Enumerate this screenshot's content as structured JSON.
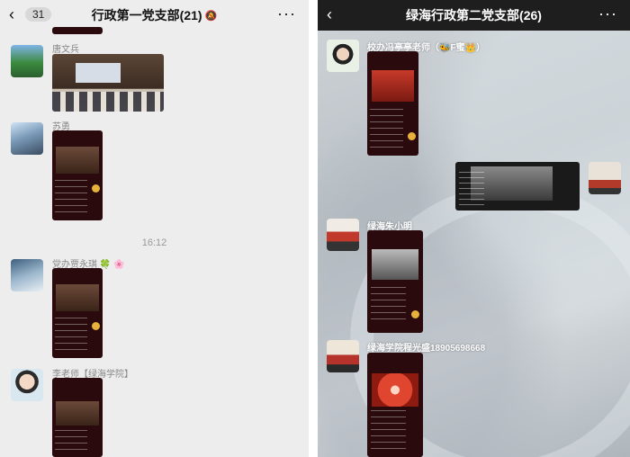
{
  "left": {
    "header": {
      "back_icon": "chevron-left-icon",
      "unread_count": "31",
      "title": "行政第一党支部(21)",
      "mute_icon": "bell-off-icon",
      "more_icon": "more-dots-icon"
    },
    "messages": [
      {
        "sender": "唐文兵"
      },
      {
        "sender": "苏勇"
      },
      {
        "sender": "党办贾永琪 🍀 🌸"
      },
      {
        "sender": "李老师【绿海学院】"
      }
    ],
    "timestamp": "16:12"
  },
  "right": {
    "header": {
      "back_icon": "chevron-left-icon",
      "title": "绿海行政第二党支部(26)",
      "more_icon": "more-dots-icon"
    },
    "messages": [
      {
        "sender": "校办冯亭亭老师（🐝F蜜👑）"
      },
      {
        "sender": "绿海朱小明"
      },
      {
        "sender": "绿海学院程光盛18905698668"
      }
    ]
  }
}
